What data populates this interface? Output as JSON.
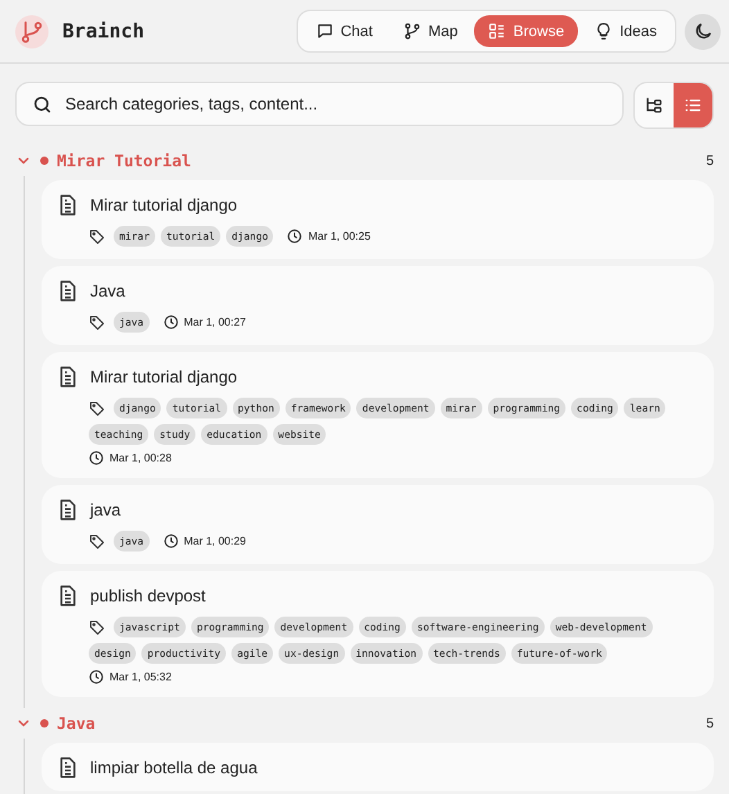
{
  "app": {
    "name": "Brainch"
  },
  "nav": [
    {
      "label": "Chat",
      "kind": "chat",
      "selected": false
    },
    {
      "label": "Map",
      "kind": "map",
      "selected": false
    },
    {
      "label": "Browse",
      "kind": "browse",
      "selected": true
    },
    {
      "label": "Ideas",
      "kind": "ideas",
      "selected": false
    }
  ],
  "search": {
    "placeholder": "Search categories, tags, content..."
  },
  "view_toggle": [
    {
      "kind": "tree",
      "selected": false
    },
    {
      "kind": "list",
      "selected": true
    }
  ],
  "groups": [
    {
      "name": "Mirar Tutorial",
      "count": "5",
      "expanded": true,
      "items": [
        {
          "title": "Mirar tutorial django",
          "tags": [
            "mirar",
            "tutorial",
            "django"
          ],
          "date": "Mar 1, 00:25"
        },
        {
          "title": "Java",
          "tags": [
            "java"
          ],
          "date": "Mar 1, 00:27"
        },
        {
          "title": "Mirar tutorial django",
          "tags": [
            "django",
            "tutorial",
            "python",
            "framework",
            "development",
            "mirar",
            "programming",
            "coding",
            "learn",
            "teaching",
            "study",
            "education",
            "website"
          ],
          "date": "Mar 1, 00:28"
        },
        {
          "title": "java",
          "tags": [
            "java"
          ],
          "date": "Mar 1, 00:29"
        },
        {
          "title": "publish devpost",
          "tags": [
            "javascript",
            "programming",
            "development",
            "coding",
            "software-engineering",
            "web-development",
            "design",
            "productivity",
            "agile",
            "ux-design",
            "innovation",
            "tech-trends",
            "future-of-work"
          ],
          "date": "Mar 1, 05:32"
        }
      ]
    },
    {
      "name": "Java",
      "count": "5",
      "expanded": true,
      "items": [
        {
          "title": "limpiar botella de agua"
        }
      ]
    }
  ]
}
